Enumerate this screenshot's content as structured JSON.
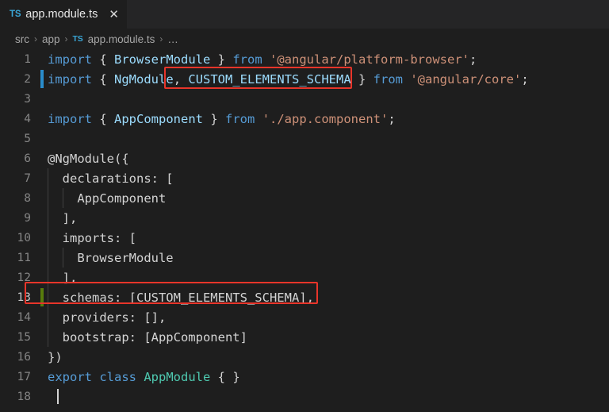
{
  "window": {
    "editor_background": "#1e1e1e",
    "tabbar_background": "#252526"
  },
  "tabbar": {
    "tabs": [
      {
        "icon_label": "TS",
        "label": "app.module.ts",
        "close_label": "✕",
        "active": true
      }
    ]
  },
  "breadcrumb": {
    "items": [
      {
        "label": "src",
        "type": "folder"
      },
      {
        "label": "app",
        "type": "folder"
      },
      {
        "label": "app.module.ts",
        "type": "file",
        "icon_label": "TS"
      },
      {
        "label": "…",
        "type": "more"
      }
    ],
    "separator": "›"
  },
  "editor": {
    "language": "typescript",
    "cursor_line": 18,
    "annotation_color": "#e8352a",
    "lines": [
      {
        "number": "1",
        "text": "import { BrowserModule } from '@angular/platform-browser';",
        "gutter_mark": "none"
      },
      {
        "number": "2",
        "text": "import { NgModule, CUSTOM_ELEMENTS_SCHEMA } from '@angular/core';",
        "gutter_mark": "modified"
      },
      {
        "number": "3",
        "text": "",
        "gutter_mark": "none"
      },
      {
        "number": "4",
        "text": "import { AppComponent } from './app.component';",
        "gutter_mark": "none"
      },
      {
        "number": "5",
        "text": "",
        "gutter_mark": "none"
      },
      {
        "number": "6",
        "text": "@NgModule({",
        "gutter_mark": "none"
      },
      {
        "number": "7",
        "text": "  declarations: [",
        "gutter_mark": "none"
      },
      {
        "number": "8",
        "text": "    AppComponent",
        "gutter_mark": "none"
      },
      {
        "number": "9",
        "text": "  ],",
        "gutter_mark": "none"
      },
      {
        "number": "10",
        "text": "  imports: [",
        "gutter_mark": "none"
      },
      {
        "number": "11",
        "text": "    BrowserModule",
        "gutter_mark": "none"
      },
      {
        "number": "12",
        "text": "  ],",
        "gutter_mark": "none"
      },
      {
        "number": "13",
        "text": "  schemas: [CUSTOM_ELEMENTS_SCHEMA],",
        "gutter_mark": "added"
      },
      {
        "number": "14",
        "text": "  providers: [],",
        "gutter_mark": "none"
      },
      {
        "number": "15",
        "text": "  bootstrap: [AppComponent]",
        "gutter_mark": "none"
      },
      {
        "number": "16",
        "text": "})",
        "gutter_mark": "none"
      },
      {
        "number": "17",
        "text": "export class AppModule { }",
        "gutter_mark": "none"
      },
      {
        "number": "18",
        "text": "",
        "gutter_mark": "none"
      }
    ],
    "annotations": [
      {
        "label": "CUSTOM_ELEMENTS_SCHEMA",
        "on_line": "2"
      },
      {
        "label": "schemas: [CUSTOM_ELEMENTS_SCHEMA],",
        "on_line": "13"
      }
    ]
  }
}
